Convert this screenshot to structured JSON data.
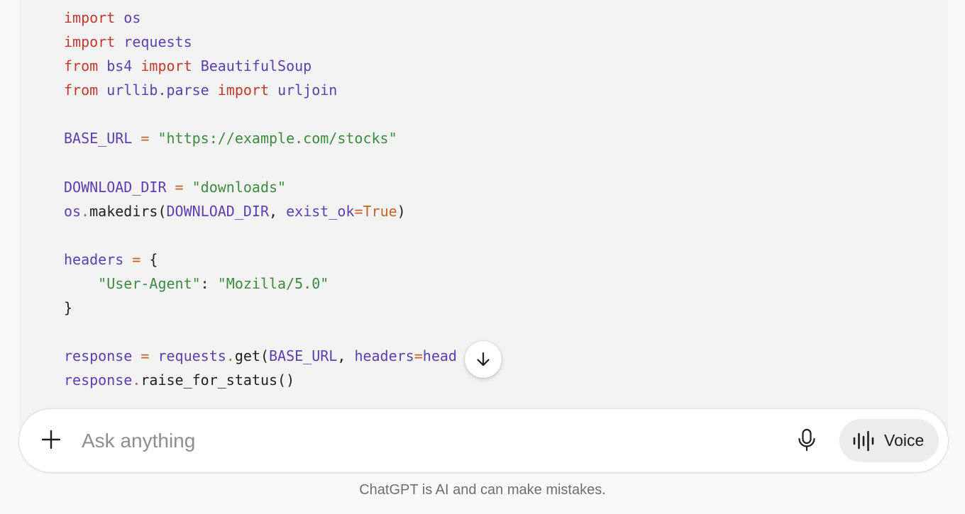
{
  "code": {
    "lines": [
      [
        {
          "t": "import",
          "c": "kw"
        },
        {
          "t": " ",
          "c": ""
        },
        {
          "t": "os",
          "c": "id"
        }
      ],
      [
        {
          "t": "import",
          "c": "kw"
        },
        {
          "t": " ",
          "c": ""
        },
        {
          "t": "requests",
          "c": "id"
        }
      ],
      [
        {
          "t": "from",
          "c": "kw"
        },
        {
          "t": " ",
          "c": ""
        },
        {
          "t": "bs4",
          "c": "id"
        },
        {
          "t": " ",
          "c": ""
        },
        {
          "t": "import",
          "c": "kw"
        },
        {
          "t": " ",
          "c": ""
        },
        {
          "t": "BeautifulSoup",
          "c": "id"
        }
      ],
      [
        {
          "t": "from",
          "c": "kw"
        },
        {
          "t": " ",
          "c": ""
        },
        {
          "t": "urllib.parse",
          "c": "id"
        },
        {
          "t": " ",
          "c": ""
        },
        {
          "t": "import",
          "c": "kw"
        },
        {
          "t": " ",
          "c": ""
        },
        {
          "t": "urljoin",
          "c": "id"
        }
      ],
      [],
      [
        {
          "t": "BASE_URL",
          "c": "id"
        },
        {
          "t": " ",
          "c": ""
        },
        {
          "t": "=",
          "c": "op"
        },
        {
          "t": " ",
          "c": ""
        },
        {
          "t": "\"https://example.com/stocks\"",
          "c": "str"
        }
      ],
      [],
      [
        {
          "t": "DOWNLOAD_DIR",
          "c": "id"
        },
        {
          "t": " ",
          "c": ""
        },
        {
          "t": "=",
          "c": "op"
        },
        {
          "t": " ",
          "c": ""
        },
        {
          "t": "\"downloads\"",
          "c": "str"
        }
      ],
      [
        {
          "t": "os",
          "c": "id"
        },
        {
          "t": ".",
          "c": "op"
        },
        {
          "t": "makedirs(",
          "c": ""
        },
        {
          "t": "DOWNLOAD_DIR",
          "c": "id"
        },
        {
          "t": ", ",
          "c": ""
        },
        {
          "t": "exist_ok",
          "c": "id"
        },
        {
          "t": "=",
          "c": "op"
        },
        {
          "t": "True",
          "c": "lit"
        },
        {
          "t": ")",
          "c": ""
        }
      ],
      [],
      [
        {
          "t": "headers",
          "c": "id"
        },
        {
          "t": " ",
          "c": ""
        },
        {
          "t": "=",
          "c": "op"
        },
        {
          "t": " {",
          "c": ""
        }
      ],
      [
        {
          "t": "    ",
          "c": ""
        },
        {
          "t": "\"User-Agent\"",
          "c": "str"
        },
        {
          "t": ": ",
          "c": ""
        },
        {
          "t": "\"Mozilla/5.0\"",
          "c": "str"
        }
      ],
      [
        {
          "t": "}",
          "c": ""
        }
      ],
      [],
      [
        {
          "t": "response",
          "c": "id"
        },
        {
          "t": " ",
          "c": ""
        },
        {
          "t": "=",
          "c": "op"
        },
        {
          "t": " ",
          "c": ""
        },
        {
          "t": "requests",
          "c": "id"
        },
        {
          "t": ".",
          "c": "op"
        },
        {
          "t": "get(",
          "c": ""
        },
        {
          "t": "BASE_URL",
          "c": "id"
        },
        {
          "t": ", ",
          "c": ""
        },
        {
          "t": "headers",
          "c": "id"
        },
        {
          "t": "=",
          "c": "op"
        },
        {
          "t": "head",
          "c": "id"
        }
      ],
      [
        {
          "t": "response",
          "c": "id"
        },
        {
          "t": ".",
          "c": "op"
        },
        {
          "t": "raise_for_status()",
          "c": ""
        }
      ]
    ]
  },
  "composer": {
    "placeholder": "Ask anything",
    "voice_label": "Voice",
    "plus_icon": "plus-icon",
    "mic_icon": "microphone-icon",
    "voice_icon": "voice-waveform-icon"
  },
  "scroll_icon": "arrow-down-icon",
  "footer": {
    "disclaimer": "ChatGPT is AI and can make mistakes."
  }
}
